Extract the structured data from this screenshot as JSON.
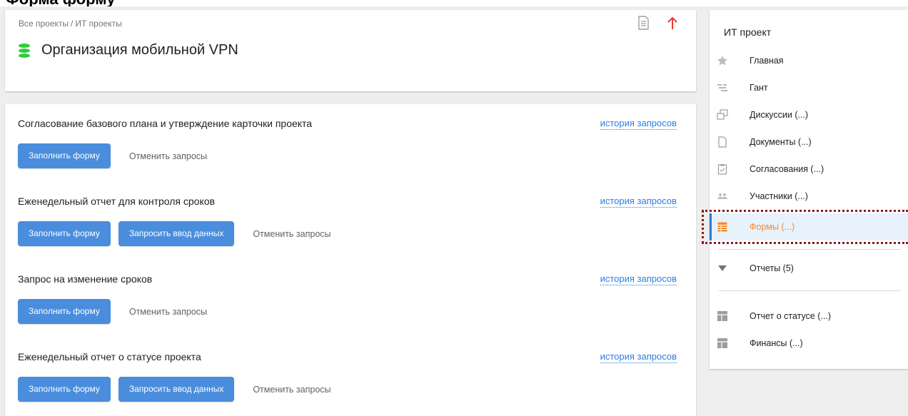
{
  "top_partial_text": "Форма                         форму",
  "breadcrumb": {
    "root": "Все проекты",
    "separator": "/",
    "current": "ИТ проекты"
  },
  "project": {
    "title": "Организация мобильной VPN"
  },
  "forms": [
    {
      "title": "Согласование базового плана и утверждение карточки проекта",
      "history": "история запросов",
      "buttons": [
        "Заполнить форму"
      ],
      "cancel": "Отменить запросы"
    },
    {
      "title": "Еженедельный отчет для контроля сроков",
      "history": "история запросов",
      "buttons": [
        "Заполнить форму",
        "Запросить ввод данных"
      ],
      "cancel": "Отменить запросы"
    },
    {
      "title": "Запрос на изменение сроков",
      "history": "история запросов",
      "buttons": [
        "Заполнить форму"
      ],
      "cancel": "Отменить запросы"
    },
    {
      "title": "Еженедельный отчет о статусе проекта",
      "history": "история запросов",
      "buttons": [
        "Заполнить форму",
        "Запросить ввод данных"
      ],
      "cancel": "Отменить запросы"
    }
  ],
  "sidebar": {
    "title": "ИТ проект",
    "items": [
      {
        "label": "Главная",
        "icon": "star-icon"
      },
      {
        "label": "Гант",
        "icon": "gantt-icon"
      },
      {
        "label": "Дискуссии (...)",
        "icon": "discussions-icon"
      },
      {
        "label": "Документы (...)",
        "icon": "document-icon"
      },
      {
        "label": "Согласования (...)",
        "icon": "clipboard-check-icon"
      },
      {
        "label": "Участники (...)",
        "icon": "people-icon"
      },
      {
        "label": "Формы (...)",
        "icon": "form-icon",
        "active": true
      },
      {
        "label": "Отчеты (5)",
        "icon": "triangle-down-icon"
      },
      {
        "label": "Отчет о статусе (...)",
        "icon": "report-table-icon"
      },
      {
        "label": "Финансы (...)",
        "icon": "report-table-icon"
      }
    ]
  },
  "colors": {
    "accent": "#4a8ddc",
    "link": "#2a7de1",
    "active_label": "#f38b2d",
    "up_arrow": "#e53935",
    "db_icon": "#2ecc40",
    "highlight_border": "#8b1a1a"
  }
}
